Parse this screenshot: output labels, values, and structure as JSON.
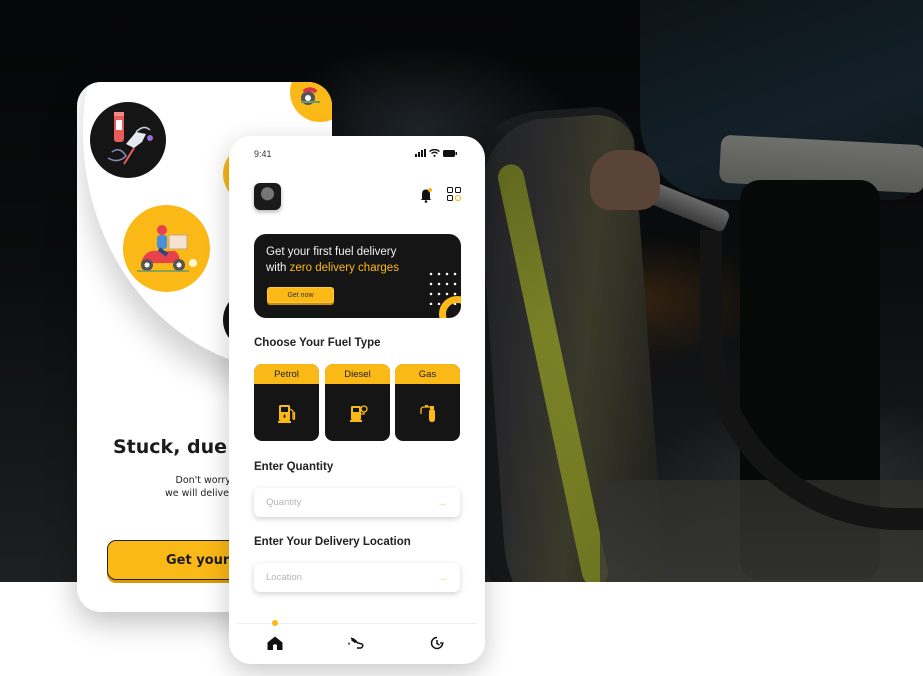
{
  "colors": {
    "accent": "#fbb917",
    "dark": "#151515",
    "white": "#ffffff"
  },
  "onboarding": {
    "headline": "Stuck, due t",
    "subtitle_line1": "Don't worry we are at",
    "subtitle_line2": "we will deliver your fuel w",
    "cta_label": "Get your F",
    "illustrations": [
      "fuel-pump-illustration",
      "delivery-scooter-illustration"
    ]
  },
  "home": {
    "status_bar": {
      "time": "9:41",
      "icons": [
        "signal-icon",
        "wifi-icon",
        "battery-icon"
      ]
    },
    "header": {
      "avatar": "user-avatar",
      "notification_icon": "bell-icon",
      "menu_icon": "grid-menu-icon"
    },
    "promo": {
      "line1": "Get your first fuel delivery",
      "line2_prefix": "with ",
      "line2_highlight": "zero delivery charges",
      "button_label": "Get now"
    },
    "fuel_section": {
      "title": "Choose Your Fuel Type",
      "options": [
        {
          "label": "Petrol",
          "icon": "petrol-pump-icon"
        },
        {
          "label": "Diesel",
          "icon": "diesel-pump-icon"
        },
        {
          "label": "Gas",
          "icon": "gas-cylinder-icon"
        }
      ]
    },
    "quantity_section": {
      "title": "Enter Quantity",
      "placeholder": "Quantity",
      "value": ""
    },
    "location_section": {
      "title": "Enter Your Delivery Location",
      "placeholder": "Location",
      "value": ""
    },
    "bottom_nav": {
      "items": [
        {
          "name": "home",
          "icon": "home-icon",
          "active": true
        },
        {
          "name": "fuel",
          "icon": "fuel-nozzle-icon",
          "active": false
        },
        {
          "name": "history",
          "icon": "history-icon",
          "active": false
        }
      ]
    }
  }
}
